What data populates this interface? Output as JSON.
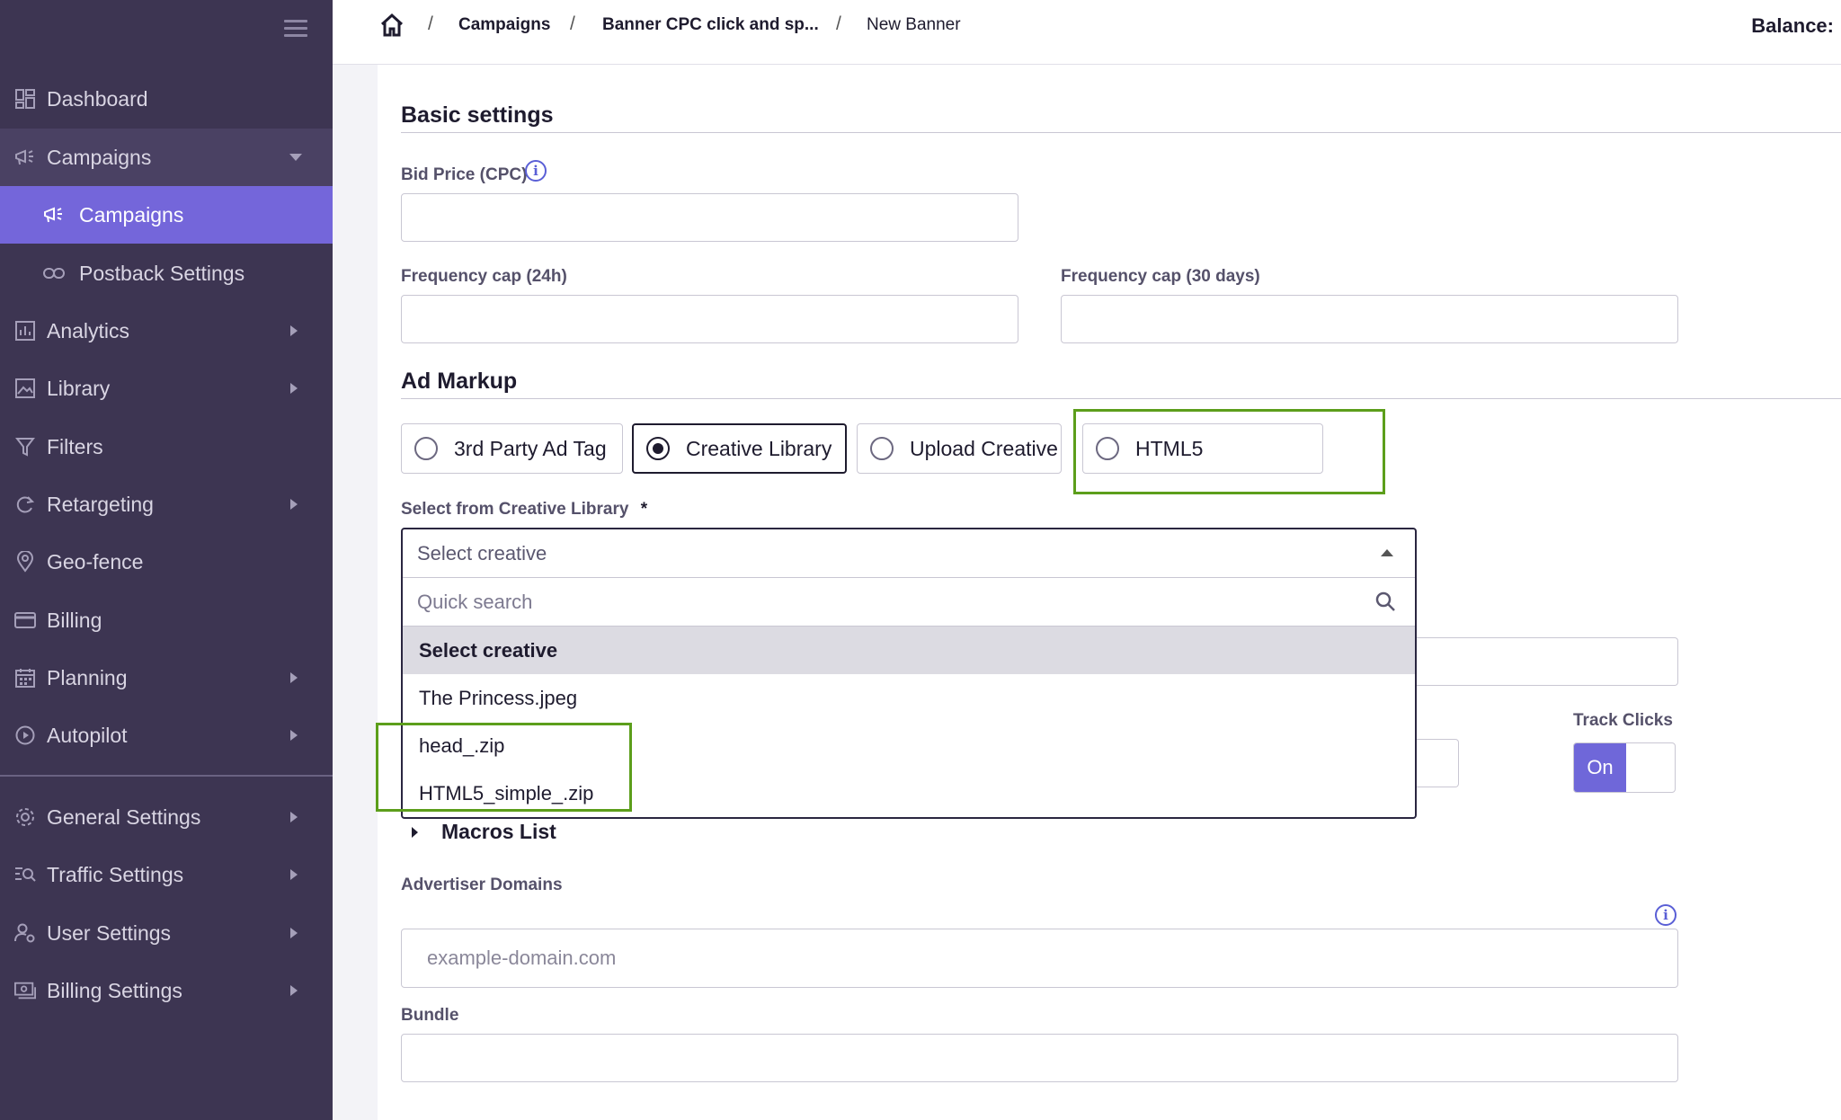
{
  "sidebar": {
    "items": [
      {
        "label": "Dashboard",
        "icon": "dashboard-icon"
      },
      {
        "label": "Campaigns",
        "icon": "megaphone-icon"
      },
      {
        "label": "Campaigns",
        "icon": "megaphone-icon"
      },
      {
        "label": "Postback Settings",
        "icon": "link-icon"
      },
      {
        "label": "Analytics",
        "icon": "bar-chart-icon"
      },
      {
        "label": "Library",
        "icon": "image-icon"
      },
      {
        "label": "Filters",
        "icon": "filter-icon"
      },
      {
        "label": "Retargeting",
        "icon": "refresh-icon"
      },
      {
        "label": "Geo-fence",
        "icon": "location-pin-icon"
      },
      {
        "label": "Billing",
        "icon": "credit-card-icon"
      },
      {
        "label": "Planning",
        "icon": "calendar-icon"
      },
      {
        "label": "Autopilot",
        "icon": "play-circle-icon"
      },
      {
        "label": "General Settings",
        "icon": "gear-icon"
      },
      {
        "label": "Traffic Settings",
        "icon": "traffic-search-icon"
      },
      {
        "label": "User Settings",
        "icon": "user-gear-icon"
      },
      {
        "label": "Billing Settings",
        "icon": "money-icon"
      }
    ]
  },
  "breadcrumb": {
    "items": [
      "Campaigns",
      "Banner CPC click and sp...",
      "New Banner"
    ],
    "separator": "/"
  },
  "header": {
    "balance_label": "Balance:"
  },
  "basic_settings": {
    "title": "Basic settings",
    "bid_price_label": "Bid Price (CPC)",
    "freq_24h_label": "Frequency cap (24h)",
    "freq_30d_label": "Frequency cap (30 days)"
  },
  "ad_markup": {
    "title": "Ad Markup",
    "options": [
      "3rd Party Ad Tag",
      "Creative Library",
      "Upload Creative",
      "HTML5"
    ],
    "selected": "Creative Library"
  },
  "creative_select": {
    "label": "Select from Creative Library",
    "required_mark": "*",
    "value": "Select creative",
    "search_placeholder": "Quick search",
    "options": [
      "Select creative",
      "The Princess.jpeg",
      "head_.zip",
      "HTML5_simple_.zip"
    ]
  },
  "track_clicks": {
    "label": "Track Clicks",
    "state": "On"
  },
  "macros": {
    "label": "Macros List"
  },
  "advertiser_domains": {
    "label": "Advertiser Domains",
    "placeholder": "example-domain.com"
  },
  "bundle": {
    "label": "Bundle"
  },
  "colors": {
    "sidebar_bg": "#3d3552",
    "active_nav": "#7466da",
    "highlight": "#5c9e1b",
    "accent": "#5a5fd6"
  }
}
